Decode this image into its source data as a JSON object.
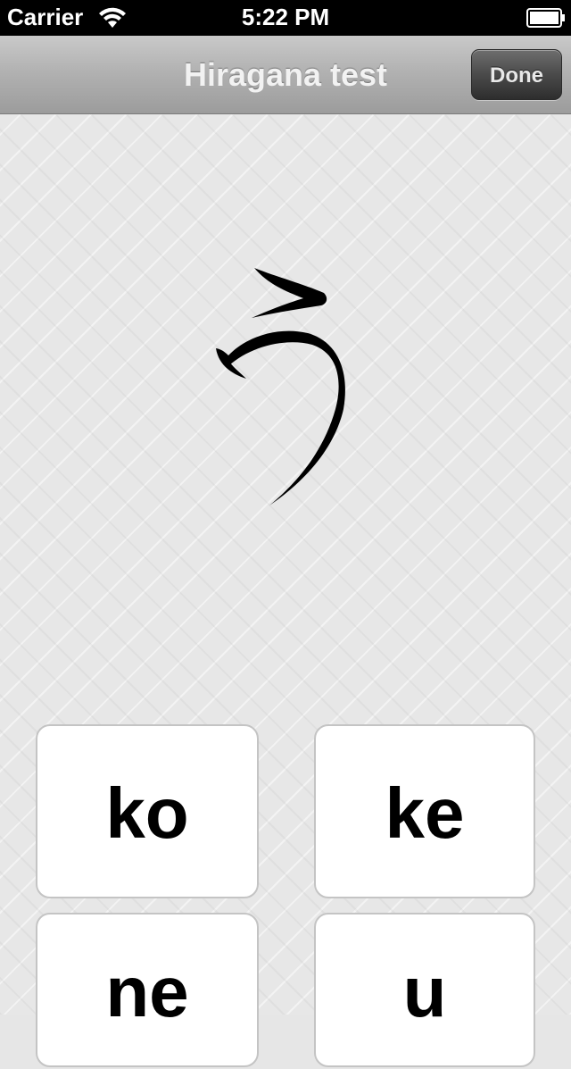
{
  "status_bar": {
    "carrier": "Carrier",
    "time": "5:22 PM",
    "wifi_icon": "wifi-icon",
    "battery_icon": "battery-icon"
  },
  "nav_bar": {
    "title": "Hiragana test",
    "done_label": "Done"
  },
  "quiz": {
    "character": "う",
    "answers": [
      "ko",
      "ke",
      "ne",
      "u"
    ]
  }
}
